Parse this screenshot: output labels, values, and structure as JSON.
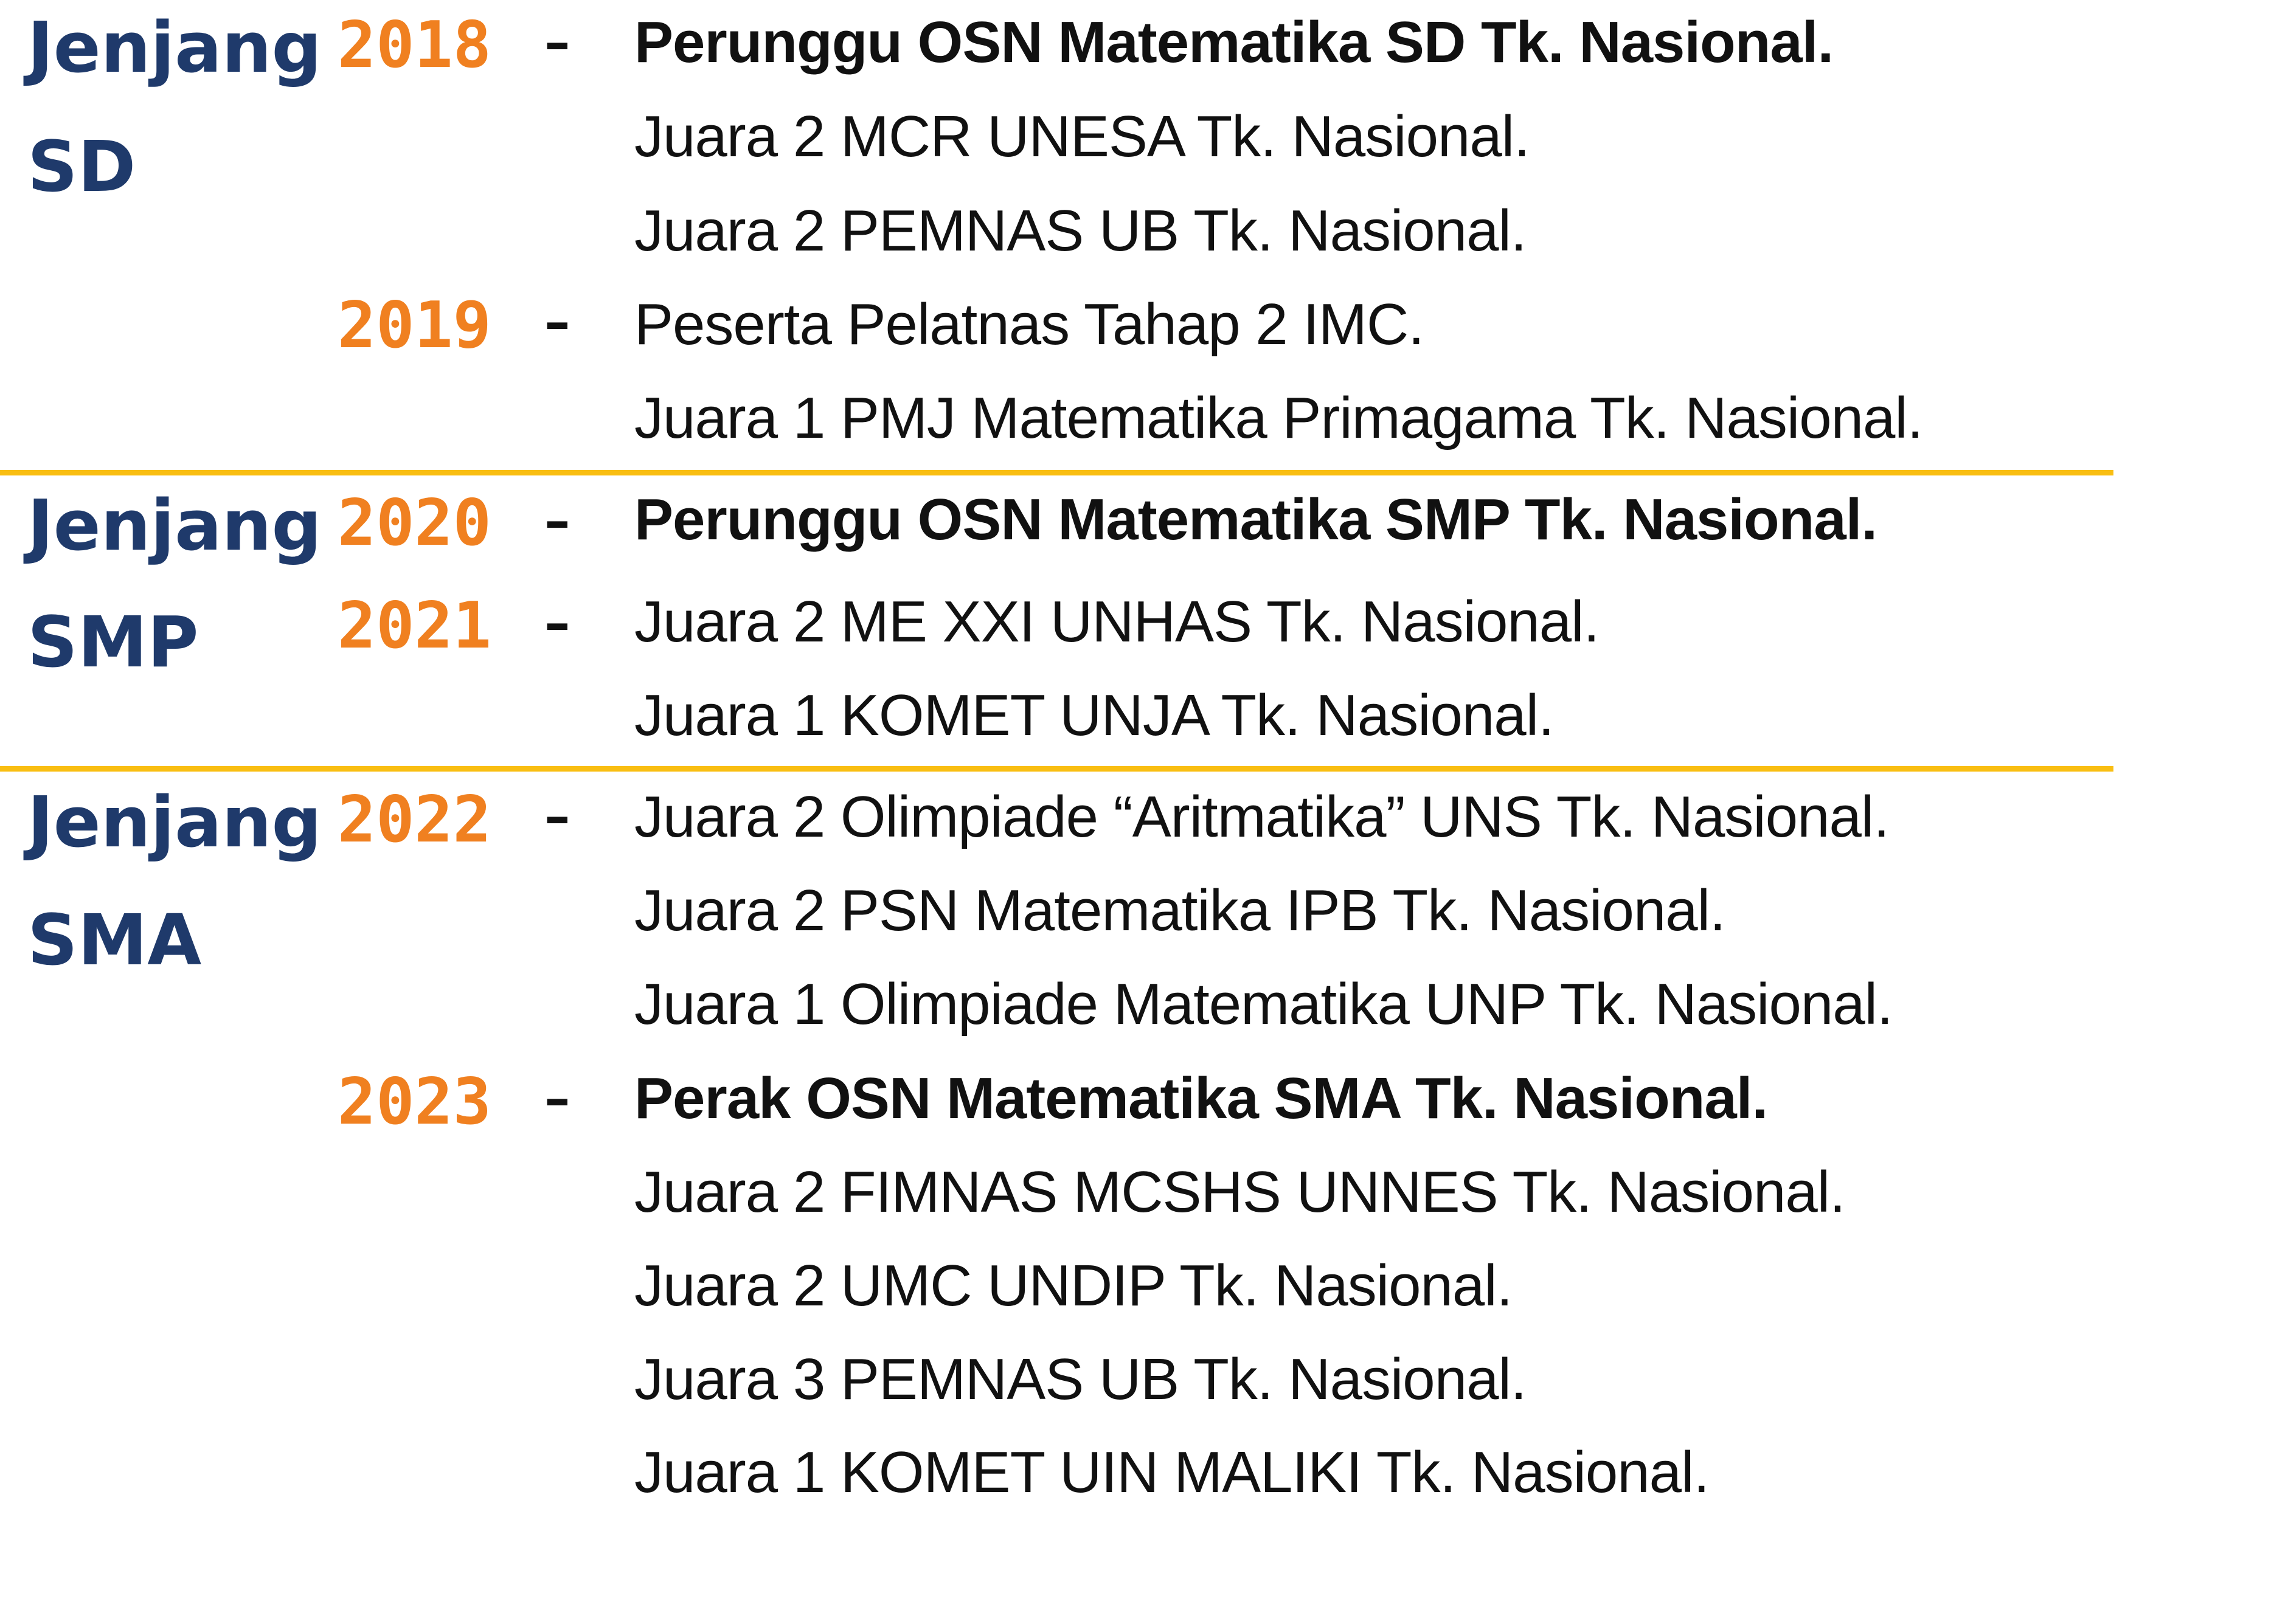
{
  "accent": {
    "level": "#1f3a6b",
    "year": "#f08020",
    "divider": "#f9be12",
    "text": "#111111"
  },
  "dash": "–",
  "sections": [
    {
      "level_line1": "Jenjang",
      "level_line2": "SD",
      "groups": [
        {
          "year": "2018",
          "items": [
            {
              "text": "Perunggu OSN Matematika SD Tk. Nasional.",
              "bold": true
            },
            {
              "text": "Juara 2 MCR UNESA Tk. Nasional.",
              "bold": false
            },
            {
              "text": "Juara 2 PEMNAS UB Tk. Nasional.",
              "bold": false
            }
          ]
        },
        {
          "year": "2019",
          "items": [
            {
              "text": "Peserta Pelatnas Tahap 2 IMC.",
              "bold": false
            },
            {
              "text": "Juara 1 PMJ Matematika Primagama Tk. Nasional.",
              "bold": false
            }
          ]
        }
      ]
    },
    {
      "level_line1": "Jenjang",
      "level_line2": "SMP",
      "groups": [
        {
          "year": "2020",
          "items": [
            {
              "text": "Perunggu OSN Matematika SMP Tk. Nasional.",
              "bold": true
            }
          ]
        },
        {
          "year": "2021",
          "items": [
            {
              "text": "Juara 2 ME XXI UNHAS Tk. Nasional.",
              "bold": false
            },
            {
              "text": "Juara 1 KOMET UNJA Tk. Nasional.",
              "bold": false
            }
          ]
        }
      ]
    },
    {
      "level_line1": "Jenjang",
      "level_line2": "SMA",
      "groups": [
        {
          "year": "2022",
          "items": [
            {
              "text": "Juara 2 Olimpiade “Aritmatika” UNS Tk. Nasional.",
              "bold": false
            },
            {
              "text": "Juara 2 PSN Matematika IPB Tk. Nasional.",
              "bold": false
            },
            {
              "text": "Juara 1 Olimpiade Matematika UNP Tk. Nasional.",
              "bold": false
            }
          ]
        },
        {
          "year": "2023",
          "items": [
            {
              "text": "Perak OSN Matematika SMA Tk. Nasional.",
              "bold": true
            },
            {
              "text": "Juara 2 FIMNAS MCSHS UNNES Tk. Nasional.",
              "bold": false
            },
            {
              "text": "Juara 2 UMC UNDIP Tk. Nasional.",
              "bold": false
            },
            {
              "text": "Juara 3 PEMNAS UB Tk. Nasional.",
              "bold": false
            },
            {
              "text": "Juara 1 KOMET UIN MALIKI Tk. Nasional.",
              "bold": false
            }
          ]
        }
      ]
    }
  ]
}
